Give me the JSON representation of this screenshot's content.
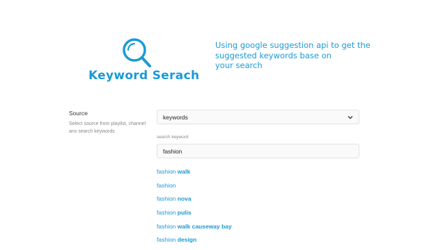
{
  "hero": {
    "title": "Keyword Serach",
    "description_lines": [
      "Using google suggestion api to get the",
      "suggested keywords base on",
      "your search"
    ],
    "accent_color": "#1a9ad6",
    "logo_icon": "search-icon"
  },
  "source_field": {
    "title": "Source",
    "help": "Select source from playlist, channel ans search keywords",
    "selected": "keywords"
  },
  "search_field": {
    "label": "search keyword",
    "value": "fashion"
  },
  "suggestions": [
    {
      "base": "fashion",
      "completion": "walk"
    },
    {
      "base": "fashion",
      "completion": ""
    },
    {
      "base": "fashion",
      "completion": "nova"
    },
    {
      "base": "fashion",
      "completion": "pulis"
    },
    {
      "base": "fashion",
      "completion": "walk causeway bay"
    },
    {
      "base": "fashion",
      "completion": "design"
    }
  ]
}
